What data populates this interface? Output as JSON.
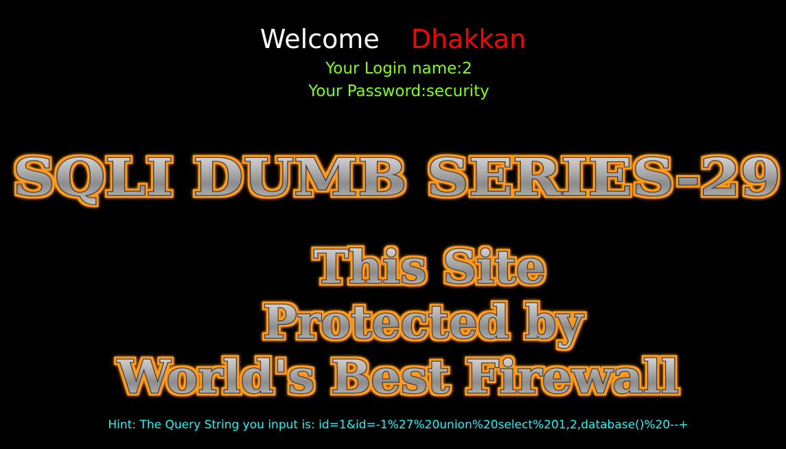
{
  "welcome": {
    "greeting": "Welcome",
    "name": "Dhakkan"
  },
  "credentials": {
    "login": "Your Login name:2",
    "password": "Your Password:security"
  },
  "banner": {
    "title": "SQLI DUMB SERIES-29",
    "line1": "This Site",
    "line2": "Protected by",
    "line3": "World's Best Firewall"
  },
  "hint": {
    "text": "Hint: The Query String you input is: id=1&id=-1%27%20union%20select%201,2,database()%20--+"
  },
  "colors": {
    "background": "#000000",
    "welcome": "#ffffff",
    "name": "#ff0000",
    "credentials": "#7fff00",
    "hint": "#00ffff",
    "banner_glow": "#ff9a1a"
  }
}
